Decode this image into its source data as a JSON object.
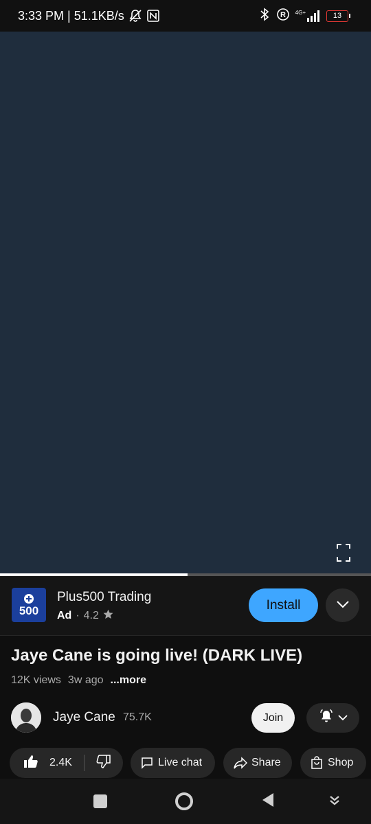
{
  "status_bar": {
    "time_speed": "3:33 PM | 51.1KB/s",
    "network": "4G+",
    "battery": "13",
    "icons": [
      "bell-muted-icon",
      "nfc-icon",
      "bluetooth-icon",
      "registered-icon",
      "signal-icon",
      "battery-icon"
    ]
  },
  "player": {
    "progress_fraction": 0.505,
    "fullscreen_icon": "fullscreen-icon"
  },
  "ad": {
    "logo_text": "500",
    "title": "Plus500 Trading",
    "tag": "Ad",
    "separator": "·",
    "rating": "4.2",
    "install_label": "Install",
    "accent": "#3ea6ff"
  },
  "video": {
    "title": "Jaye Cane is going live! (DARK LIVE)",
    "views": "12K views",
    "age": "3w ago",
    "more": "...more"
  },
  "channel": {
    "name": "Jaye Cane",
    "subscribers": "75.7K",
    "join_label": "Join"
  },
  "actions": {
    "likes": "2.4K",
    "live_chat": "Live chat",
    "share": "Share",
    "shop": "Shop"
  },
  "nav_bar": {
    "icons": [
      "square-icon",
      "circle-home-icon",
      "triangle-back-icon",
      "down-arrow-icon"
    ]
  }
}
